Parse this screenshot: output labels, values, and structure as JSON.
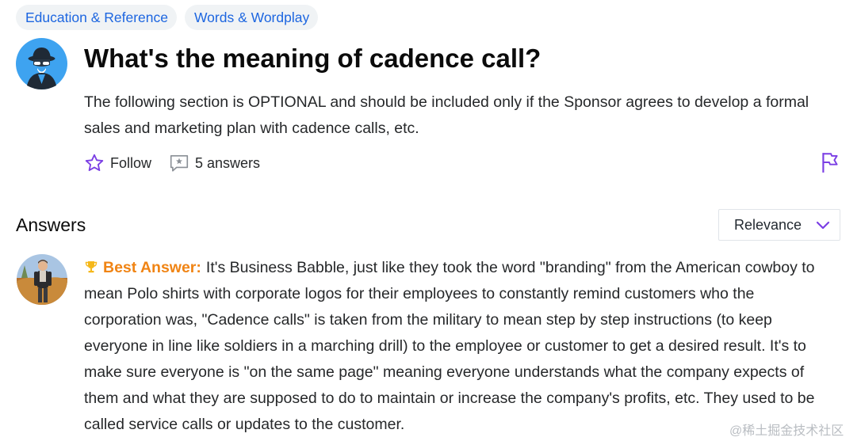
{
  "tags": [
    "Education & Reference",
    "Words & Wordplay"
  ],
  "question": {
    "title": "What's the meaning of cadence call?",
    "detail": "The following section is OPTIONAL and should be included only if the Sponsor agrees to develop a formal sales and marketing plan with cadence calls, etc.",
    "follow_label": "Follow",
    "answers_count_label": "5 answers"
  },
  "answers_section": {
    "heading": "Answers",
    "sort_label": "Relevance"
  },
  "best_answer": {
    "label": "Best Answer:",
    "text": "It's Business Babble, just like they took the word \"branding\" from the American cowboy to mean Polo shirts with corporate logos for their employees to constantly remind customers who the corporation was, \"Cadence calls\" is taken from the military to mean step by step instructions (to keep everyone in line like soldiers in a marching drill) to the employee or customer to get a desired result. It's to make sure everyone is \"on the same page\" meaning everyone understands what the company expects of them and what they are supposed to do to maintain or increase the company's profits, etc. They used to be called service calls or updates to the customer."
  },
  "watermark": "@稀土掘金技术社区",
  "icons": {
    "follow": "star-outline-icon",
    "answers": "speech-bubble-star-icon",
    "report": "flag-icon",
    "sort": "chevron-down-icon",
    "best_answer": "trophy-icon"
  },
  "colors": {
    "tag_text": "#1d66e0",
    "tag_bg": "#f0f3f5",
    "accent_purple": "#7b3fe4",
    "best_answer": "#f08414",
    "avatar_bg": "#3ea3f0"
  }
}
